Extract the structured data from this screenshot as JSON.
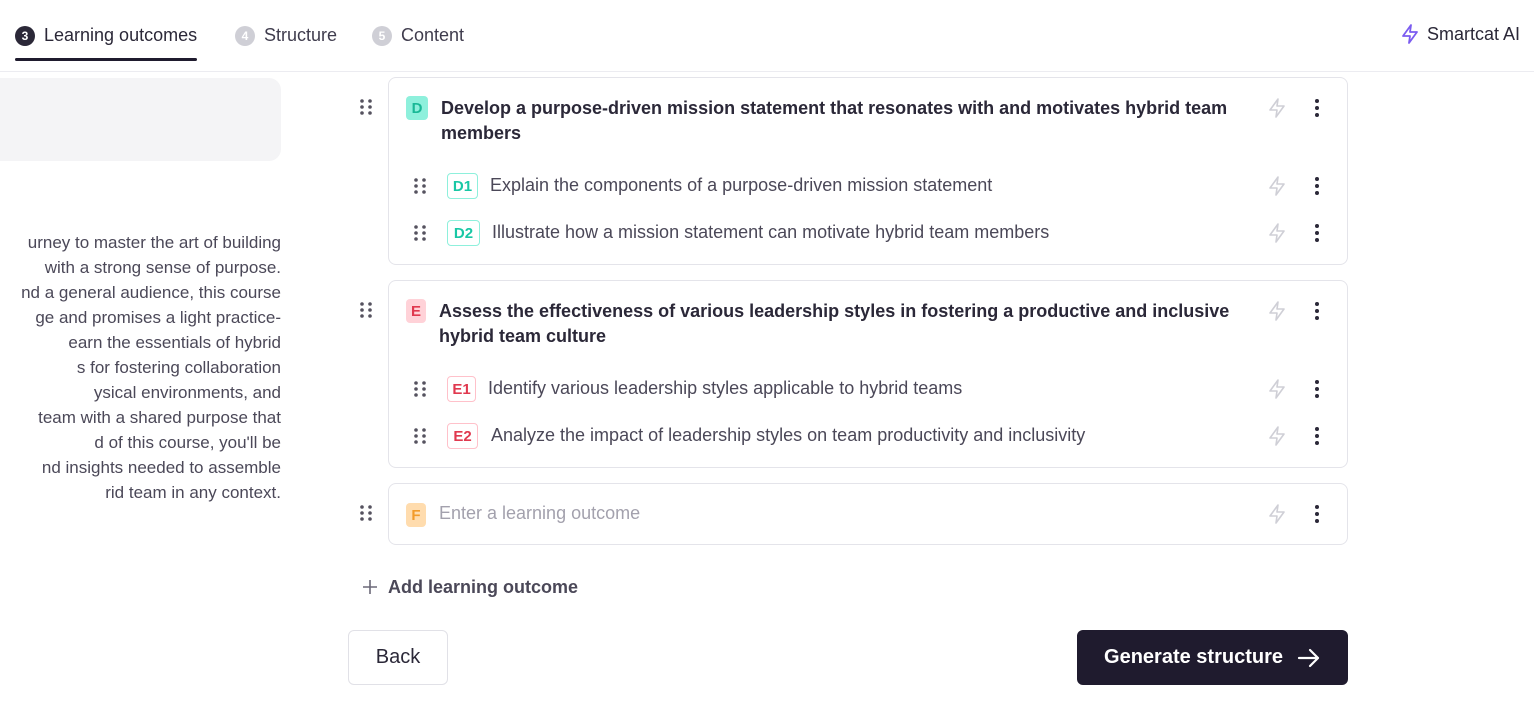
{
  "steps": [
    {
      "num": "3",
      "label": "Learning outcomes",
      "active": true
    },
    {
      "num": "4",
      "label": "Structure"
    },
    {
      "num": "5",
      "label": "Content"
    }
  ],
  "smartcat_label": "Smartcat AI",
  "description_lines": [
    "urney to master the art of building",
    "with a strong sense of purpose.",
    "nd a general audience, this course",
    "ge and promises a light practice-",
    "earn the essentials of hybrid",
    "s for fostering collaboration",
    "ysical environments, and",
    "team with a shared purpose that",
    "d of this course, you'll be",
    "nd insights needed to assemble",
    "rid team in any context."
  ],
  "outcomes": [
    {
      "letter": "D",
      "title": "Develop a purpose-driven mission statement that resonates with and motivates hybrid team members",
      "children": [
        {
          "code": "D1",
          "text": "Explain the components of a purpose-driven mission statement"
        },
        {
          "code": "D2",
          "text": "Illustrate how a mission statement can motivate hybrid team members"
        }
      ]
    },
    {
      "letter": "E",
      "title": "Assess the effectiveness of various leadership styles in fostering a productive and inclusive hybrid team culture",
      "children": [
        {
          "code": "E1",
          "text": "Identify various leadership styles applicable to hybrid teams"
        },
        {
          "code": "E2",
          "text": "Analyze the impact of leadership styles on team productivity and inclusivity"
        }
      ]
    }
  ],
  "new_outcome": {
    "letter": "F",
    "placeholder": "Enter a learning outcome"
  },
  "add_outcome_label": "Add learning outcome",
  "back_label": "Back",
  "generate_label": "Generate structure",
  "colors": {
    "teal": "#19c7a5",
    "teal_bg": "#8ef0dc",
    "red": "#e0394f",
    "red_bg": "#ffd2d8",
    "orange": "#f29b2b",
    "orange_bg": "#ffdcae",
    "dark": "#1f1b2e",
    "accent_purple": "#7b5cf0"
  }
}
